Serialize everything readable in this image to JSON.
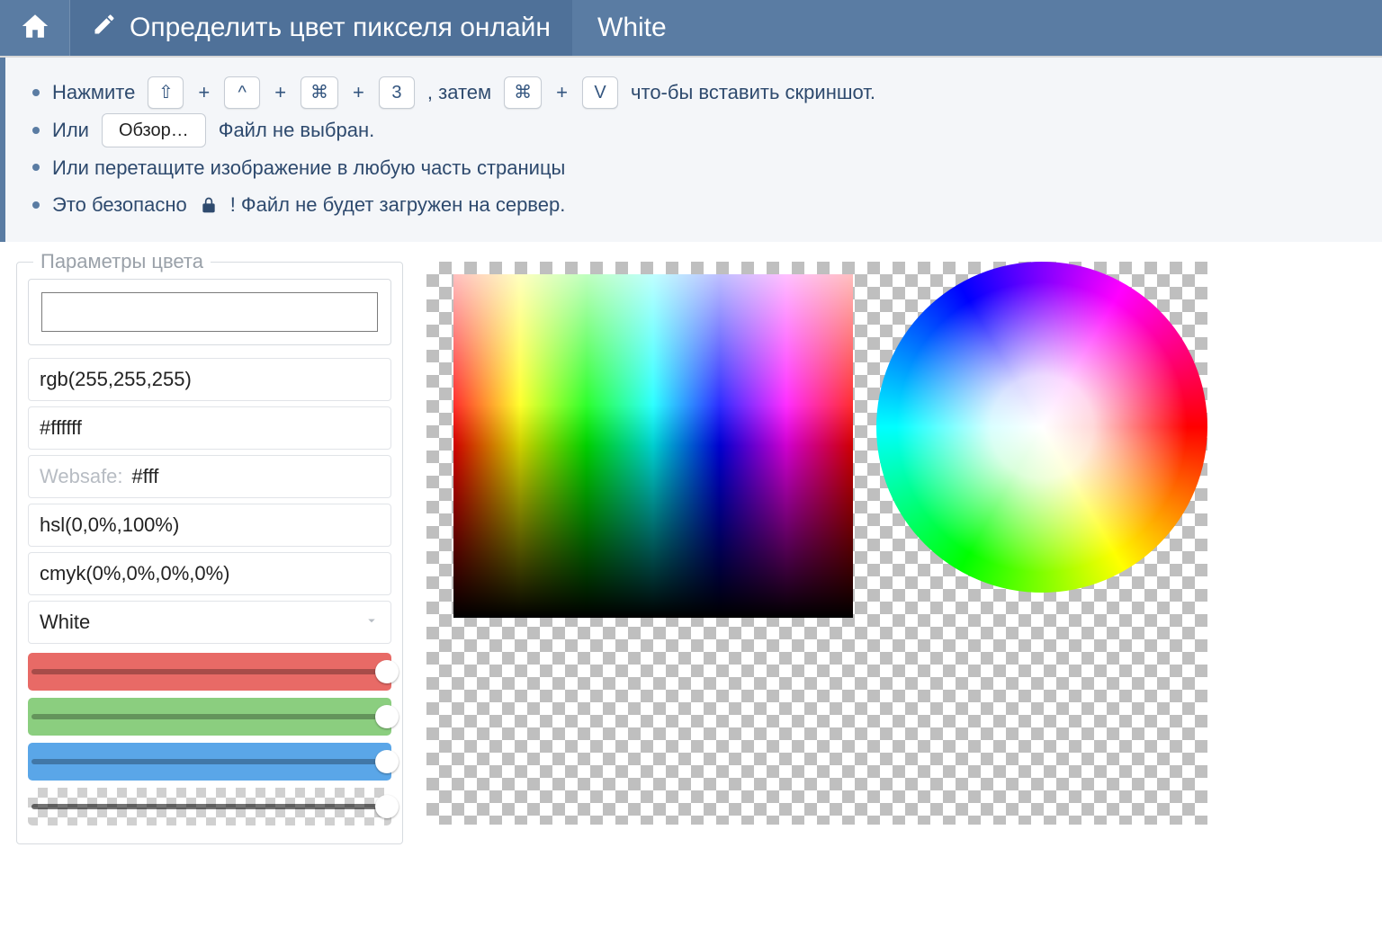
{
  "header": {
    "title": "Определить цвет пикселя онлайн",
    "color_name": "White"
  },
  "info": {
    "line1_prefix": "Нажмите",
    "keys1": [
      "⇧",
      "^",
      "⌘",
      "3"
    ],
    "line1_mid": ", затем",
    "keys2": [
      "⌘",
      "V"
    ],
    "line1_suffix": "что-бы вставить скриншот.",
    "line2_prefix": "Или",
    "browse_label": "Обзор…",
    "line2_suffix": "Файл не выбран.",
    "line3": "Или перетащите изображение в любую часть страницы",
    "line4_prefix": "Это безопасно",
    "line4_suffix": "! Файл не будет загружен на сервер."
  },
  "params": {
    "legend": "Параметры цвета",
    "rgb": "rgb(255,255,255)",
    "hex": "#ffffff",
    "websafe_label": "Websafe:",
    "websafe_value": "#fff",
    "hsl": "hsl(0,0%,100%)",
    "cmyk": "cmyk(0%,0%,0%,0%)",
    "name": "White",
    "swatch_color": "#ffffff"
  },
  "sliders": {
    "r": 255,
    "g": 255,
    "b": 255,
    "a": 255
  }
}
